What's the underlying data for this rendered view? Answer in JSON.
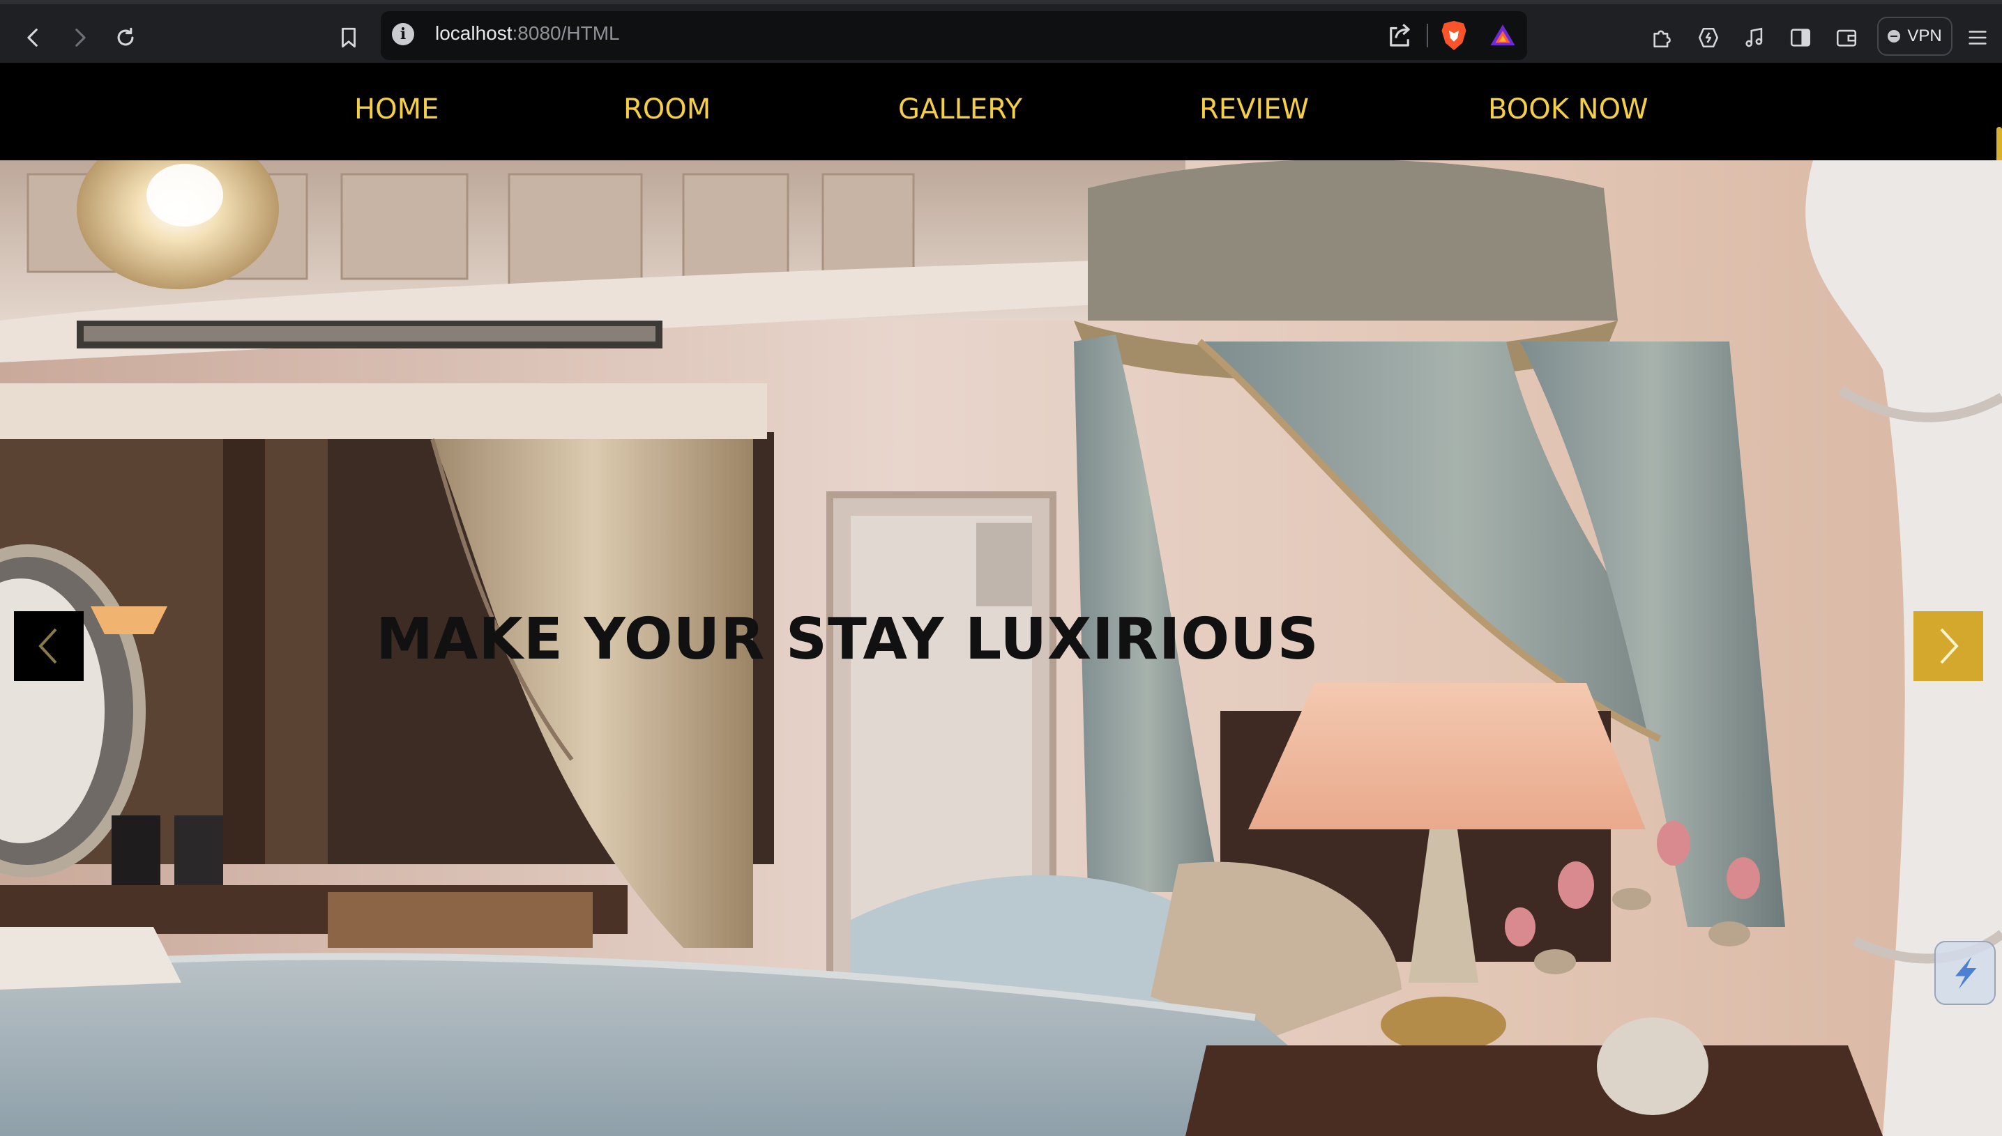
{
  "browser": {
    "url_host": "localhost",
    "url_path": ":8080/HTML",
    "vpn_label": "VPN",
    "icons": {
      "back": "arrow-left-icon",
      "forward": "arrow-right-icon",
      "reload": "reload-icon",
      "bookmark": "bookmark-icon",
      "site_info": "info-icon",
      "share": "share-icon",
      "shields": "brave-shield-icon",
      "rewards": "brave-rewards-icon",
      "extensions": "puzzle-icon",
      "leo": "leo-ai-icon",
      "media": "music-note-icon",
      "sidebar": "sidebar-icon",
      "wallet": "wallet-icon",
      "menu": "hamburger-icon"
    }
  },
  "nav": {
    "items": [
      {
        "label": "HOME"
      },
      {
        "label": "ROOM"
      },
      {
        "label": "GALLERY"
      },
      {
        "label": "REVIEW"
      },
      {
        "label": "BOOK NOW"
      }
    ],
    "color": "#f4cf46"
  },
  "hero": {
    "title": "MAKE YOUR STAY LUXIRIOUS",
    "prev_icon": "chevron-left-icon",
    "next_icon": "chevron-right-icon",
    "next_button_color": "#d4a82c"
  }
}
